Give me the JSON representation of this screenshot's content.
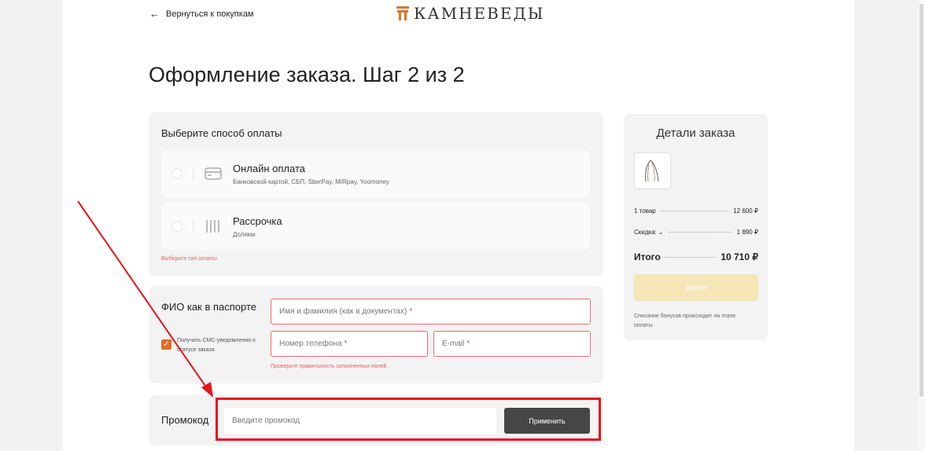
{
  "header": {
    "back_label": "Вернуться к покупкам",
    "logo_text": "КАМНЕВЕДЫ"
  },
  "page_title": "Оформление заказа. Шаг 2 из 2",
  "payment": {
    "title": "Выберите способ оплаты",
    "options": [
      {
        "name": "Онлайн оплата",
        "sub": "Банковской картой, СБП, SberPay, MIRpay, Yoomoney",
        "icon": "card-icon"
      },
      {
        "name": "Рассрочка",
        "sub": "Долями",
        "icon": "bars-icon"
      }
    ],
    "error": "Выберите тип оплаты"
  },
  "contacts": {
    "title": "ФИО как в паспорте",
    "sms_label": "Получать СМС-уведомления о статусе заказа",
    "name_placeholder": "Имя и фамилия (как в документах)",
    "phone_placeholder": "Номер телефона",
    "email_placeholder": "E-mail",
    "required_mark": "*",
    "error": "Проверьте правильность заполненных полей"
  },
  "promo": {
    "title": "Промокод",
    "placeholder": "Введите промокод",
    "apply_label": "Применить"
  },
  "summary": {
    "title": "Детали заказа",
    "items_label": "1 товар",
    "items_value": "12 600 ₽",
    "discount_label": "Скидка:",
    "discount_value": "1 890 ₽",
    "total_label": "Итого",
    "total_value": "10 710 ₽",
    "next_label": "Далее",
    "bonus_note": "Списание бонусов происходит на этапе оплаты"
  },
  "colors": {
    "accent": "#e06b2a",
    "error": "#e86060",
    "annotation": "#e4141b",
    "button_dark": "#464646",
    "button_disabled": "#f5e7b8"
  }
}
